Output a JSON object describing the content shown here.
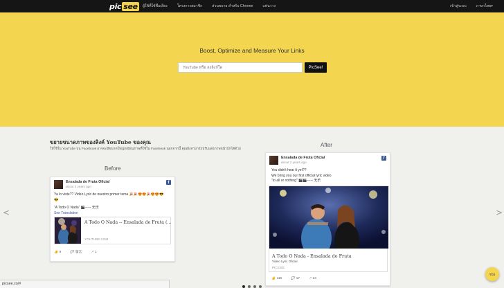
{
  "logo": {
    "prefix": "pic",
    "suffix": "see"
  },
  "nav": {
    "left": [
      "ผู้ใช้ที่ใช้ชื่อเสียง",
      "โครงการสมาชิก",
      "ส่วนขยาย สำหรับ Chrome",
      "แท่นวาง"
    ],
    "right": [
      "เข้าสู่ระบบ",
      "ภาษาไทย▾"
    ]
  },
  "hero": {
    "title": "Boost, Optimize and Measure Your Links",
    "search_placeholder": "YouTube หรือ ลงลิงก์ใด",
    "button": "PicSee!"
  },
  "section": {
    "title": "ขยายขนาดภาพของลิงค์ YouTube ของคุณ",
    "desc": "ให้ใช้ใน YouTube บน Facebook อาจจะมีขนาดใหญ่เหมือนภาพที่ใช้ใน Facebook นอกจากนี้ คุณยังสามารถปรับแต่งภาพหน้าปกได้ด้วย",
    "before_label": "Before",
    "after_label": "After"
  },
  "before_card": {
    "page_name": "Ensalada de Fruta Oficial",
    "time": "about 2 years ago",
    "lines": [
      "Ya lo viste?? Video Lyric de nuestro primer tema 🎉🎉😍😍🎉😍😍😎",
      "😎"
    ],
    "quote": "\"A Todo O Nada\" 🎬----- 无乐",
    "see_translation": "See Translation",
    "link_title": "A Todo O Nada -- Ensalada de Fruta (...",
    "link_domain": "YOUTUBE.COM",
    "likes": "6",
    "comments": "留言",
    "shares": "1"
  },
  "after_card": {
    "page_name": "Ensalada de Fruta Oficial",
    "time": "about 2 years ago",
    "lines": [
      "You didn't hear it yet??",
      "We bring you our first official lyric video",
      "\"to all or nothing\" 🎬🎬----- 无乐"
    ],
    "link_title": "A Todo O Nada - Ensalada de Fruta",
    "link_sub": "Video Lyric Oficial",
    "link_domain": "PICS.EE",
    "likes": "116",
    "comments": "17",
    "shares": "34"
  },
  "carousel": {
    "prev": "<",
    "next": ">",
    "dots": 4
  },
  "status_url": "picsee.co/#",
  "help_label": "ช่วย",
  "colors": {
    "hero": "#f3d550",
    "topbar": "#151515",
    "button": "#111111",
    "facebook": "#3b5998"
  }
}
